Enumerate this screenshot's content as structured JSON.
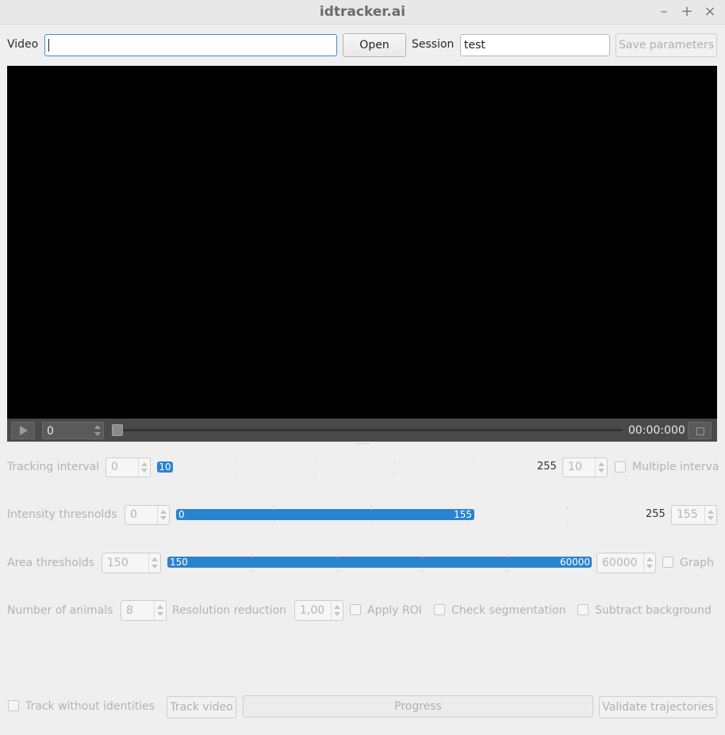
{
  "window": {
    "title": "idtracker.ai",
    "minimize": "–",
    "maximize": "+",
    "close": "×"
  },
  "top": {
    "video_label": "Video",
    "video_value": "",
    "open_button": "Open",
    "session_label": "Session",
    "session_value": "test",
    "save_button": "Save parameters"
  },
  "player": {
    "frame_value": "0",
    "time": "00:00:000"
  },
  "tracking": {
    "label": "Tracking interval",
    "min_spin": "0",
    "bar_value": "10",
    "max_tick": "255",
    "max_spin": "10",
    "multiple_label": "Multiple interva"
  },
  "intensity": {
    "label": "Intensity thresnolds",
    "min_spin": "0",
    "bar_low": "0",
    "bar_high": "155",
    "max_tick": "255",
    "max_spin": "155"
  },
  "area": {
    "label": "Area thresholds",
    "min_spin": "150",
    "bar_low": "150",
    "bar_high": "60000",
    "max_spin": "60000",
    "graph_label": "Graph"
  },
  "options": {
    "animals_label": "Number of animals",
    "animals_value": "8",
    "resolution_label": "Resolution reduction",
    "resolution_value": "1,00",
    "apply_roi": "Apply ROI",
    "check_segmentation": "Check segmentation",
    "subtract_background": "Subtract background"
  },
  "bottom": {
    "track_without_ids": "Track without identities",
    "track_video": "Track video",
    "progress": "Progress",
    "validate": "Validate trajectories"
  },
  "colors": {
    "accent": "#2a83cf",
    "focus": "#3d8fd1",
    "video_bg": "#000000"
  }
}
